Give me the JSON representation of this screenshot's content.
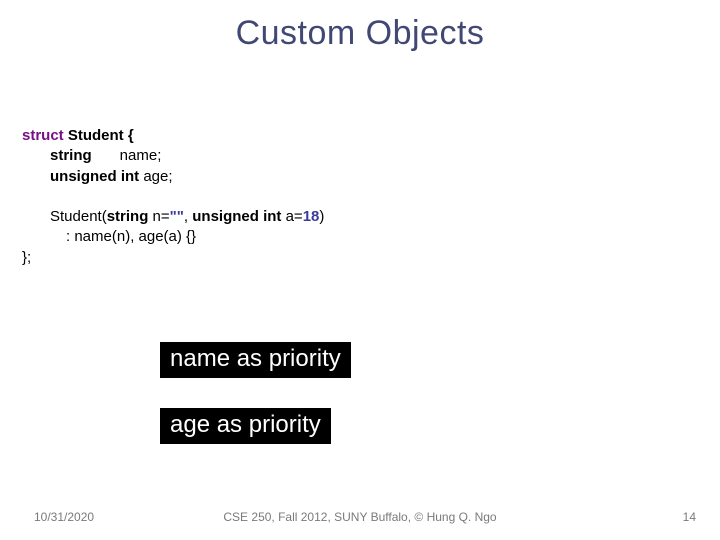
{
  "title": "Custom Objects",
  "code": {
    "struct_kw": "struct",
    "struct_name": " Student {",
    "field1_type": "string",
    "field1_name": "name",
    "field1_semi": ";",
    "field2_mod": "unsigned int ",
    "field2_name": "age",
    "field2_semi": ";",
    "ctor_name": "Student(",
    "ctor_p1_type": "string",
    "ctor_p1_rest": " n=",
    "ctor_p1_str": "\"\"",
    "ctor_comma": ", ",
    "ctor_p2_type": "unsigned int ",
    "ctor_p2_rest": "a=",
    "ctor_p2_val": "18",
    "ctor_close": ")",
    "ctor_init": ": name(n), age(a) {}",
    "close": "};"
  },
  "box1": "name as priority",
  "box2": "age as priority",
  "footer": {
    "date": "10/31/2020",
    "center": "CSE 250, Fall 2012, SUNY Buffalo, © Hung Q. Ngo",
    "page": "14"
  }
}
